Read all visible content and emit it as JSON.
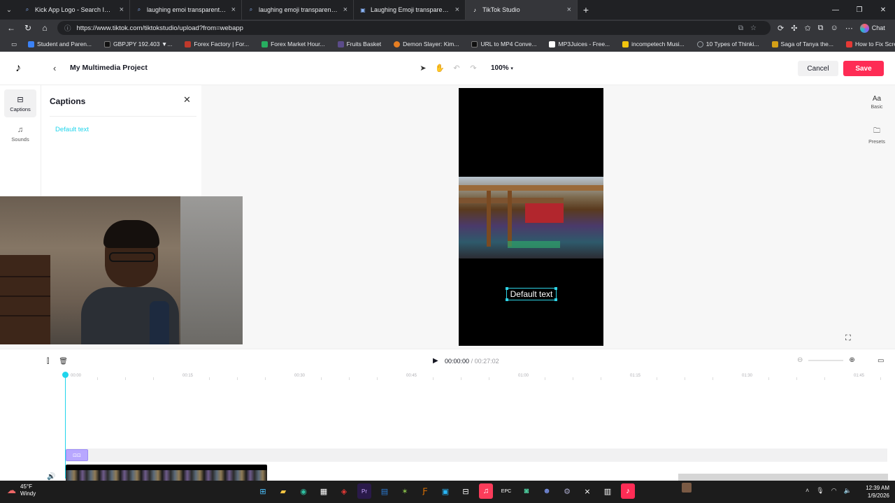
{
  "browser": {
    "tabs": [
      {
        "label": "Kick App Logo - Search Images",
        "icon": "search-icon"
      },
      {
        "label": "laughing emoi transparent - Search",
        "icon": "search-icon"
      },
      {
        "label": "laughing emoji transparent - Search",
        "icon": "search-icon"
      },
      {
        "label": "Laughing Emoji transparent PNG",
        "icon": "image-icon"
      },
      {
        "label": "TikTok Studio",
        "icon": "tiktok-icon",
        "active": true
      }
    ],
    "url": "https://www.tiktok.com/tiktokstudio/upload?from=webapp",
    "chat_label": "Chat",
    "bookmarks": [
      {
        "label": "Student and Paren...",
        "color": "#3b82f6"
      },
      {
        "label": "GBPJPY 192.403 ▼...",
        "color": "#111111"
      },
      {
        "label": "Forex Factory | For...",
        "color": "#c0392b"
      },
      {
        "label": "Forex Market Hour...",
        "color": "#27ae60"
      },
      {
        "label": "Fruits Basket",
        "color": "#5b4b8a"
      },
      {
        "label": "Demon Slayer: Kim...",
        "color": "#e67e22"
      },
      {
        "label": "URL to MP4 Conve...",
        "color": "#111111"
      },
      {
        "label": "MP3Juices - Free...",
        "color": "#ffffff"
      },
      {
        "label": "incompetech Musi...",
        "color": "#f1c40f"
      },
      {
        "label": "10 Types of Thinki...",
        "color": "#9aa0a6"
      },
      {
        "label": "Saga of Tanya the...",
        "color": "#d4a017"
      },
      {
        "label": "How to Fix Screen...",
        "color": "#e53935"
      }
    ]
  },
  "app": {
    "project_title": "My Multimedia Project",
    "zoom": "100%",
    "cancel_label": "Cancel",
    "save_label": "Save",
    "accent": "#fe2c55",
    "highlight": "#20d5ec",
    "left_rail": [
      {
        "label": "Captions",
        "icon": "captions-icon",
        "active": true
      },
      {
        "label": "Sounds",
        "icon": "music-note-icon"
      }
    ],
    "right_rail": [
      {
        "label": "Basic",
        "icon": "text-style-icon"
      },
      {
        "label": "Presets",
        "icon": "folder-icon"
      }
    ],
    "captions_panel": {
      "title": "Captions",
      "items": [
        "Default text"
      ]
    },
    "preview": {
      "caption_text": "Default text"
    },
    "timeline": {
      "current_time": "00:00:00",
      "separator": "/",
      "total_time": "00:27:02",
      "ruler_ticks": [
        "00:00",
        "00:15",
        "00:30",
        "00:45",
        "01:00",
        "01:15",
        "01:30",
        "01:45"
      ]
    }
  },
  "taskbar": {
    "temperature": "45°F",
    "weather": "Windy",
    "time": "12:39 AM",
    "date": "1/9/2026"
  }
}
